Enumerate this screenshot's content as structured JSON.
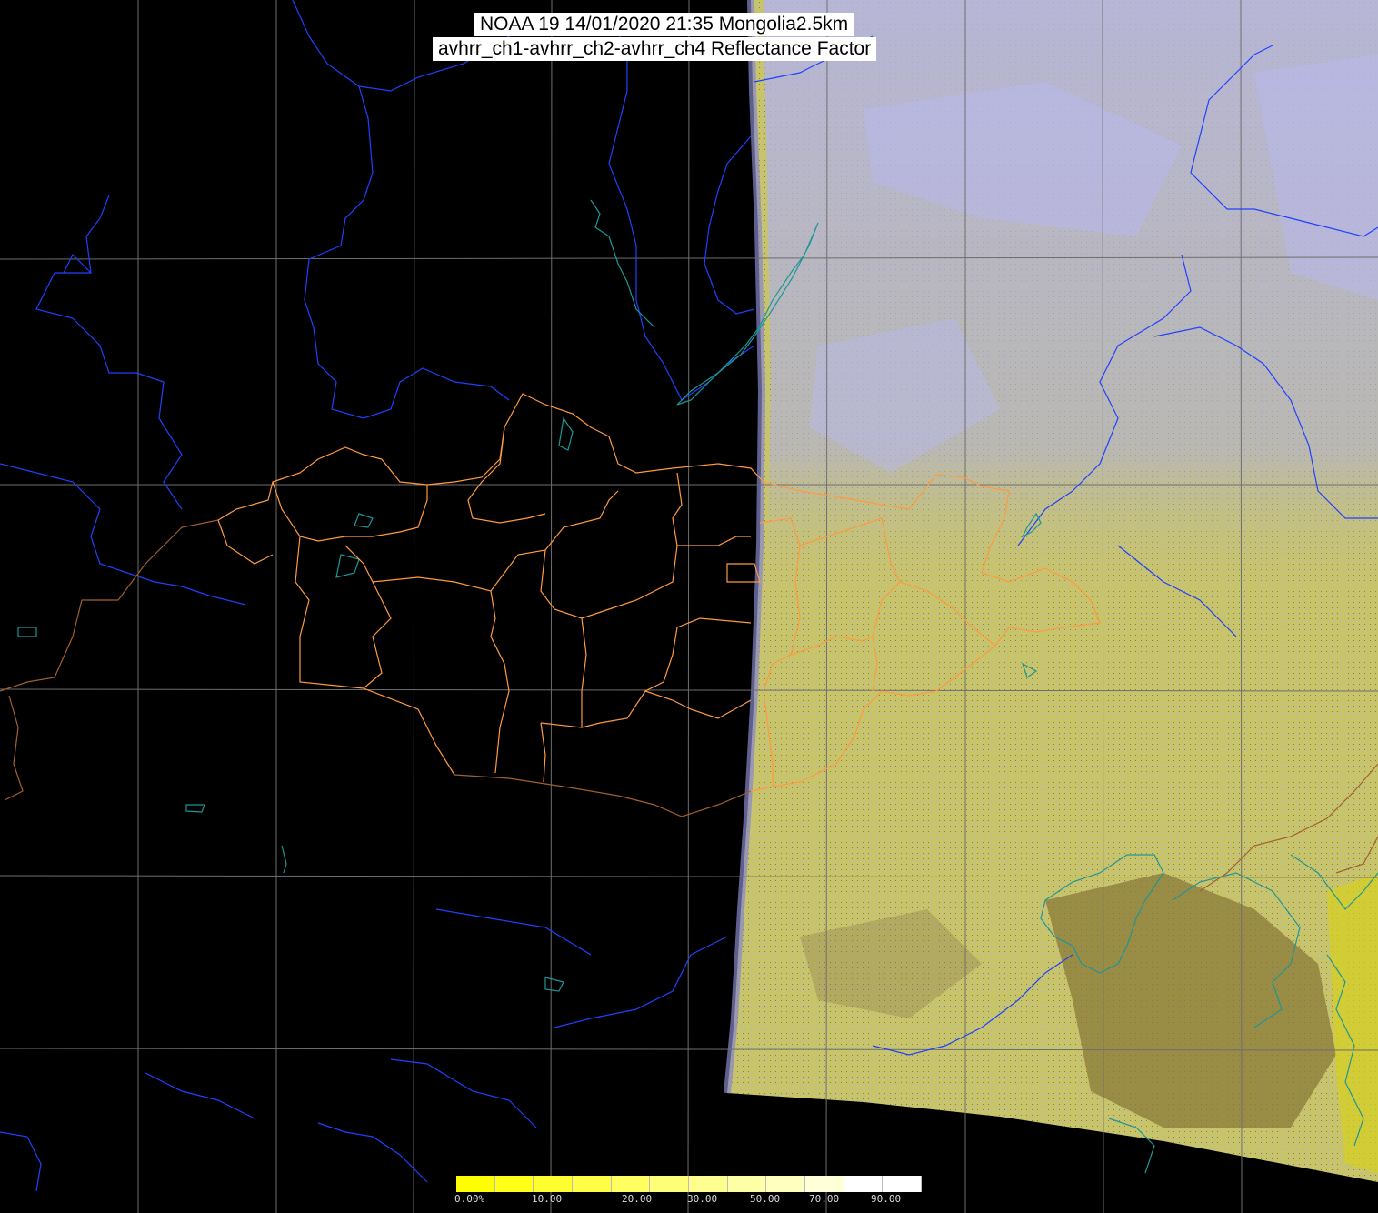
{
  "title": {
    "line1": "NOAA 19 14/01/2020 21:35 Mongolia2.5km",
    "line2": "avhrr_ch1-avhrr_ch2-avhrr_ch4 Reflectance Factor"
  },
  "colorbar": {
    "tick_labels": [
      "0.00%",
      "10.00",
      "20.00",
      "30.00",
      "50.00",
      "70.00",
      "90.00"
    ],
    "colors": [
      "#ffff00",
      "#ffff18",
      "#ffff30",
      "#ffff48",
      "#ffff60",
      "#ffff78",
      "#ffff90",
      "#ffffa8",
      "#ffffc0",
      "#ffffd8",
      "#ffffff",
      "#ffffff"
    ]
  },
  "colors": {
    "background": "#000000",
    "grid": "#6e6e6e",
    "image_base": "#c8c46a",
    "snow": "#b0b0e8",
    "bare_ground": "#8a7a48",
    "rivers": "#2040ff",
    "coast_lakes": "#1e8c8c",
    "admin_borders": "#ff9a40",
    "country_borders": "#a06030"
  }
}
